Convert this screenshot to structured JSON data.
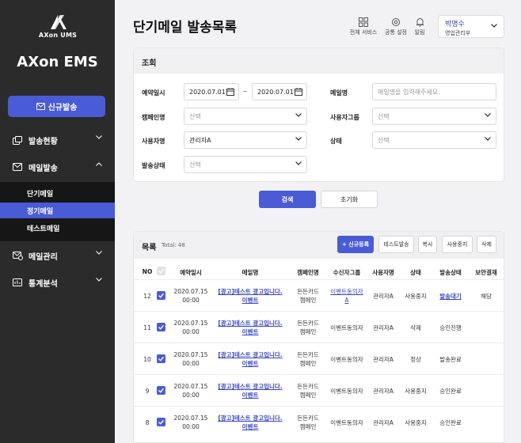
{
  "sidebar": {
    "logo_text": "AXon UMS",
    "logo_sub": "ON",
    "app_title": "AXon EMS",
    "new_send_label": "신규발송",
    "groups": [
      {
        "label": "발송현황",
        "icon": "send-status-icon"
      },
      {
        "label": "메일발송",
        "icon": "mail-icon"
      },
      {
        "label": "메일관리",
        "icon": "mail-settings-icon"
      },
      {
        "label": "통계분석",
        "icon": "stats-icon"
      }
    ],
    "sub_items": [
      {
        "label": "단기메일"
      },
      {
        "label": "정기메일"
      },
      {
        "label": "테스트메일"
      }
    ]
  },
  "header": {
    "title": "단기메일 발송목록",
    "icons": [
      {
        "label": "전체 서비스",
        "icon": "grid-icon"
      },
      {
        "label": "공통 설정",
        "icon": "gear-icon"
      },
      {
        "label": "알림",
        "icon": "bell-icon"
      }
    ],
    "user_name": "박명수",
    "user_dept": "영업관리부"
  },
  "search": {
    "title": "조회",
    "labels": {
      "reserve_date": "예약일시",
      "mail_name": "메일명",
      "campaign": "캠페인명",
      "user_group": "사용자그룹",
      "user": "사용자명",
      "status": "상태",
      "send_status": "발송상태"
    },
    "date_from": "2020.07.01",
    "date_to": "2020.07.01",
    "date_sep": "~",
    "mail_name_placeholder": "메일명을 입력해주세요.",
    "campaign_value": "선택",
    "user_group_value": "선택",
    "user_value": "관리자A",
    "status_value": "선택",
    "send_status_value": "선택",
    "search_label": "검색",
    "reset_label": "초기화"
  },
  "list": {
    "title": "목록",
    "total": "Total: 48",
    "buttons": {
      "new": "+ 신규등록",
      "test": "테스트발송",
      "copy": "복사",
      "stop": "사용중지",
      "delete": "삭제"
    },
    "columns": [
      "NO",
      "",
      "예약일시",
      "메일명",
      "캠페인명",
      "수신자그룹",
      "사용자명",
      "상태",
      "발송상태",
      "보안결재"
    ],
    "rows": [
      {
        "no": "12",
        "date": "2020.07.15",
        "time": "00:00",
        "mail1": "[광고]테스트 광고입니다.",
        "mail2": "이벤트",
        "camp1": "든든카드",
        "camp2": "캠페인",
        "group1": "이벤트동의자",
        "group2": "A",
        "group_link": true,
        "user": "관리자A",
        "state": "사용중지",
        "send": "발송대기",
        "send_link": true,
        "approval": "해당"
      },
      {
        "no": "11",
        "date": "2020.07.15",
        "time": "00:00",
        "mail1": "[광고]테스트 광고입니다.",
        "mail2": "이벤트",
        "camp1": "든든카드",
        "camp2": "캠페인",
        "group1": "이벤트동의자",
        "group2": "",
        "group_link": false,
        "user": "관리자A",
        "state": "삭제",
        "send": "승인진행",
        "send_link": false,
        "approval": ""
      },
      {
        "no": "10",
        "date": "2020.07.15",
        "time": "00:00",
        "mail1": "[광고]테스트 광고입니다.",
        "mail2": "이벤트",
        "camp1": "든든카드",
        "camp2": "캠페인",
        "group1": "이벤트동의자",
        "group2": "",
        "group_link": false,
        "user": "관리자A",
        "state": "정상",
        "send": "발송완료",
        "send_link": false,
        "approval": ""
      },
      {
        "no": "9",
        "date": "2020.07.15",
        "time": "00:00",
        "mail1": "[광고]테스트 광고입니다.",
        "mail2": "이벤트",
        "camp1": "든든카드",
        "camp2": "캠페인",
        "group1": "이벤트동의자",
        "group2": "",
        "group_link": false,
        "user": "관리자A",
        "state": "사용중지",
        "send": "승인완료",
        "send_link": false,
        "approval": ""
      },
      {
        "no": "8",
        "date": "2020.07.15",
        "time": "00:00",
        "mail1": "[광고]테스트 광고입니다.",
        "mail2": "이벤트",
        "camp1": "든든카드",
        "camp2": "캠페인",
        "group1": "이벤트동의자",
        "group2": "",
        "group_link": false,
        "user": "관리자A",
        "state": "사용중지",
        "send": "승인완료",
        "send_link": false,
        "approval": ""
      }
    ]
  },
  "colors": {
    "accent": "#4a5bd6",
    "sidebar_bg": "#2b2b2b",
    "link": "#3846c4"
  }
}
